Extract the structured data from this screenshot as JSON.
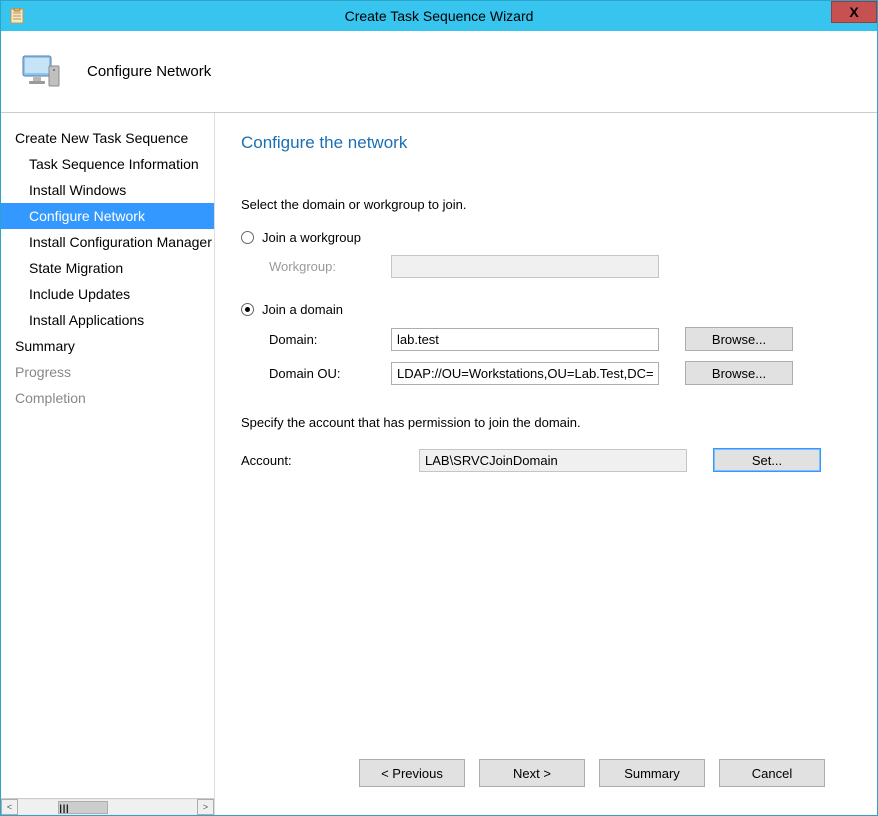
{
  "window": {
    "title": "Create Task Sequence Wizard",
    "close_label": "X"
  },
  "header": {
    "title": "Configure Network"
  },
  "sidebar": {
    "items": [
      {
        "label": "Create New Task Sequence",
        "indent": false,
        "selected": false,
        "disabled": false
      },
      {
        "label": "Task Sequence Information",
        "indent": true,
        "selected": false,
        "disabled": false
      },
      {
        "label": "Install Windows",
        "indent": true,
        "selected": false,
        "disabled": false
      },
      {
        "label": "Configure Network",
        "indent": true,
        "selected": true,
        "disabled": false
      },
      {
        "label": "Install Configuration Manager",
        "indent": true,
        "selected": false,
        "disabled": false
      },
      {
        "label": "State Migration",
        "indent": true,
        "selected": false,
        "disabled": false
      },
      {
        "label": "Include Updates",
        "indent": true,
        "selected": false,
        "disabled": false
      },
      {
        "label": "Install Applications",
        "indent": true,
        "selected": false,
        "disabled": false
      },
      {
        "label": "Summary",
        "indent": false,
        "selected": false,
        "disabled": false
      },
      {
        "label": "Progress",
        "indent": false,
        "selected": false,
        "disabled": true
      },
      {
        "label": "Completion",
        "indent": false,
        "selected": false,
        "disabled": true
      }
    ],
    "scroll_thumb_label": "III"
  },
  "content": {
    "heading": "Configure the network",
    "instruction1": "Select the domain or workgroup to join.",
    "radio_workgroup": "Join a workgroup",
    "radio_domain": "Join a domain",
    "label_workgroup": "Workgroup:",
    "label_domain": "Domain:",
    "label_domain_ou": "Domain OU:",
    "value_workgroup": "",
    "value_domain": "lab.test",
    "value_domain_ou": "LDAP://OU=Workstations,OU=Lab.Test,DC=l",
    "browse_label": "Browse...",
    "instruction2": "Specify the account that has permission to join the domain.",
    "label_account": "Account:",
    "value_account": "LAB\\SRVCJoinDomain",
    "set_label": "Set..."
  },
  "footer": {
    "previous": "< Previous",
    "next": "Next >",
    "summary": "Summary",
    "cancel": "Cancel"
  }
}
